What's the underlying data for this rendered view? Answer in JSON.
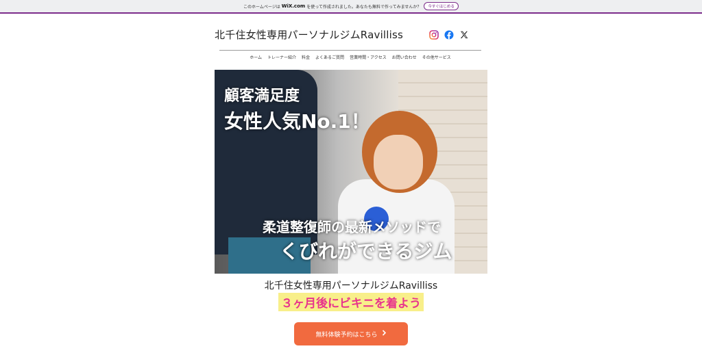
{
  "wix_banner": {
    "text_before": "このホームページは",
    "brand": "WiX.com",
    "text_after": "を使って作成されました。あなたも無料で作ってみませんか？",
    "cta": "今すぐはじめる"
  },
  "header": {
    "site_title": "北千住女性専用パーソナルジムRavilliss",
    "social": [
      "instagram-icon",
      "facebook-icon",
      "x-icon"
    ]
  },
  "nav": {
    "items": [
      "ホーム",
      "トレーナー紹介",
      "料金",
      "よくあるご質問",
      "営業時間・アクセス",
      "お問い合わせ",
      "その他サービス"
    ]
  },
  "hero": {
    "line1": "顧客満足度",
    "line2": "女性人気No.1！",
    "line3": "柔道整復師の最新メソッドで",
    "line4": "くびれができるジム"
  },
  "content": {
    "subtitle": "北千住女性専用パーソナルジムRavilliss",
    "tagline": "３ヶ月後にビキニを着よう",
    "cta_label": "無料体験予約はこちら"
  },
  "colors": {
    "wix_accent": "#7b2b8a",
    "cta_bg": "#f16a3f",
    "tagline_bg": "#f8ef8a",
    "tagline_text": "#e8348c"
  }
}
